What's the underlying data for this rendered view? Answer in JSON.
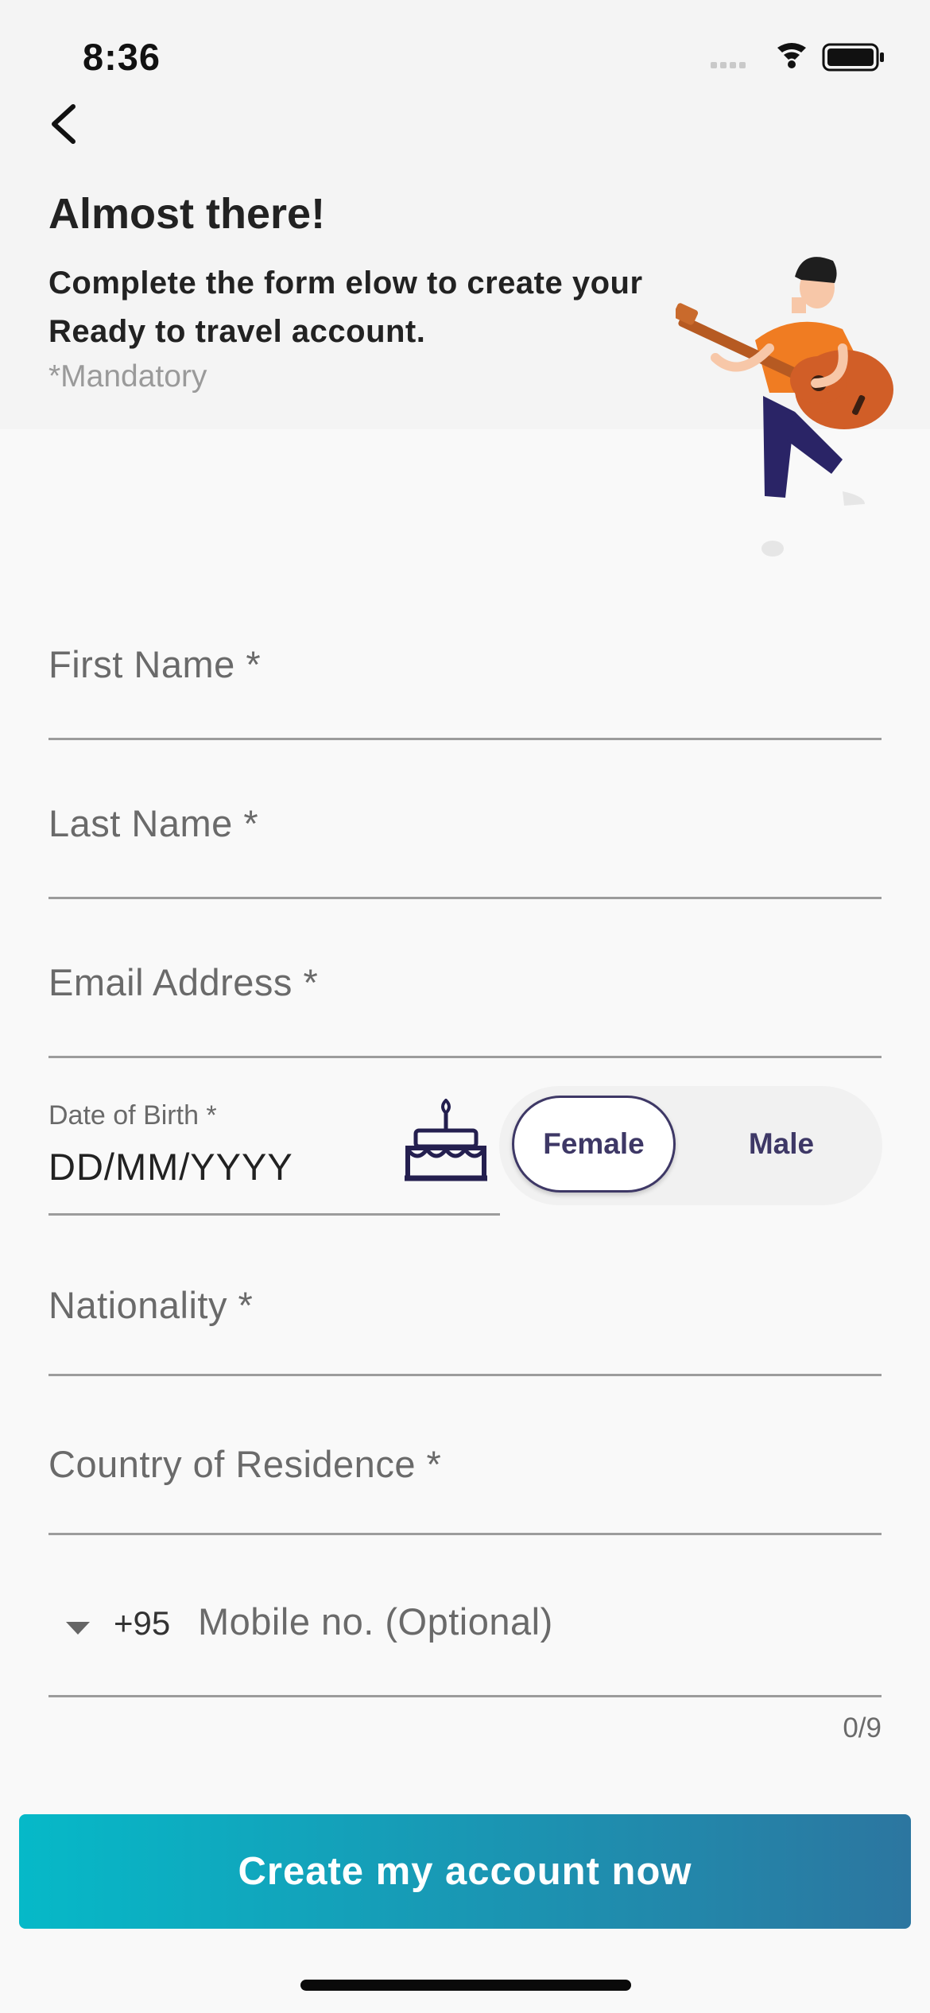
{
  "status_bar": {
    "time": "8:36"
  },
  "header": {
    "title": "Almost there!",
    "subtitle": "Complete the form elow to create your Ready to travel account.",
    "mandatory_note": "*Mandatory"
  },
  "form": {
    "first_name": {
      "placeholder": "First Name *"
    },
    "last_name": {
      "placeholder": "Last Name *"
    },
    "email": {
      "placeholder": "Email Address *"
    },
    "dob": {
      "label": "Date of Birth *",
      "placeholder": "DD/MM/YYYY",
      "icon": "cake-icon"
    },
    "gender": {
      "options": [
        "Female",
        "Male"
      ],
      "selected": "Female"
    },
    "nationality": {
      "placeholder": "Nationality *"
    },
    "residence": {
      "placeholder": "Country of Residence *"
    },
    "mobile": {
      "country_code": "+95",
      "placeholder": "Mobile no. (Optional)",
      "counter": "0/9"
    }
  },
  "cta": {
    "label": "Create my account now"
  },
  "colors": {
    "accent_dark": "#3e3866",
    "gradient_start": "#06b9c8",
    "gradient_end": "#2c76a0",
    "illustration_orange": "#f07c22"
  }
}
